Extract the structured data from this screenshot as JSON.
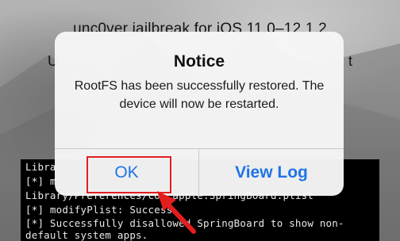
{
  "app": {
    "title": "unc0ver jailbreak for iOS 11.0–12.1.2",
    "subtitle_left": "U",
    "subtitle_right": "t"
  },
  "console": {
    "lines": [
      "Libra",
      "[*] m",
      "Library/Preferences/com.apple.SpringBoard.plist",
      "[*] modifyPlist: Success",
      "[*] Successfully disallowed SpringBoard to show non-",
      "default system apps."
    ]
  },
  "alert": {
    "title": "Notice",
    "message": "RootFS has been successfully restored. The device will now be restarted.",
    "ok_label": "OK",
    "view_log_label": "View Log"
  },
  "annotation": {
    "highlight_color": "#e21e1e"
  },
  "colors": {
    "ios_blue": "#1f74e6",
    "console_bg": "#000000"
  }
}
